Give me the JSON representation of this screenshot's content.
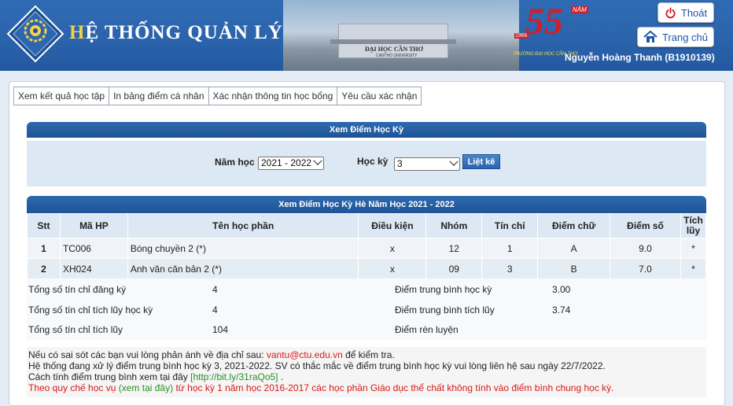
{
  "header": {
    "title_first": "H",
    "title_rest": "Ệ THỐNG QUẢN LÝ",
    "logo_text": "ĐẠI HỌC CẦN THƠ",
    "campus_name": "ĐẠI HỌC CẦN THƠ",
    "campus_subname": "CANTHO UNIVERSITY",
    "anniv_number": "55",
    "anniv_nam": "NĂM",
    "anniv_year": "1966",
    "anniv_caption": "TRƯỜNG ĐẠI HỌC CẦN THƠ",
    "logout_label": "Thoát",
    "home_label": "Trang chủ",
    "username": "Nguyễn Hoàng Thanh (B1910139)"
  },
  "tabs": [
    {
      "label": "Xem kết quả học tập"
    },
    {
      "label": "In bảng điểm cá nhân"
    },
    {
      "label": "Xác nhận thông tin học bổng"
    },
    {
      "label": "Yêu cầu xác nhận"
    }
  ],
  "filter": {
    "title": "Xem Điểm Học Kỳ",
    "year_label": "Năm học",
    "year_value": "2021 - 2022",
    "semester_label": "Học kỳ",
    "semester_value": "3",
    "list_button": "Liệt kê"
  },
  "grades": {
    "title": "Xem Điểm Học Kỳ Hè Năm Học 2021 - 2022",
    "columns": [
      "Stt",
      "Mã HP",
      "Tên học phần",
      "Điều kiện",
      "Nhóm",
      "Tín chỉ",
      "Điểm chữ",
      "Điểm số",
      "Tích lũy"
    ],
    "rows": [
      {
        "stt": "1",
        "code": "TC006",
        "name": "Bóng chuyền 2 (*)",
        "condition": "x",
        "group": "12",
        "credits": "1",
        "letter": "A",
        "score": "9.0",
        "accum": "*"
      },
      {
        "stt": "2",
        "code": "XH024",
        "name": "Anh văn căn bản 2 (*)",
        "condition": "x",
        "group": "09",
        "credits": "3",
        "letter": "B",
        "score": "7.0",
        "accum": "*"
      }
    ]
  },
  "summary": {
    "registered_label": "Tổng số tín chỉ đăng ký",
    "registered_value": "4",
    "semester_accum_label": "Tổng số tín chỉ tích lũy học kỳ",
    "semester_accum_value": "4",
    "total_accum_label": "Tổng số tín chỉ tích lũy",
    "total_accum_value": "104",
    "gpa_sem_label": "Điểm trung bình học kỳ",
    "gpa_sem_value": "3.00",
    "gpa_accum_label": "Điểm trung bình tích lũy",
    "gpa_accum_value": "3.74",
    "conduct_label": "Điểm rèn luyện",
    "conduct_value": ""
  },
  "notes": {
    "line1_before": "Nếu có sai sót các bạn vui lòng phản ánh về địa chỉ sau: ",
    "line1_email": "vantu@ctu.edu.vn",
    "line1_after": " để kiểm tra.",
    "line2": "Hệ thống đang xử lý điểm trung bình học kỳ 3, 2021-2022. SV có thắc mắc về điểm trung bình học kỳ vui lòng liên hệ sau ngày 22/7/2022.",
    "line3_before": "Cách tính điểm trung bình xem tại đây ",
    "line3_link": "[http://bit.ly/31raQo5]",
    "line3_after": " .",
    "line4_before": "Theo quy chế học vụ ",
    "line4_link": "(xem tại đây)",
    "line4_after": " từ học kỳ 1 năm học 2016-2017 các học phần Giáo dục thể chất không tính vào điểm bình chung học kỳ."
  }
}
